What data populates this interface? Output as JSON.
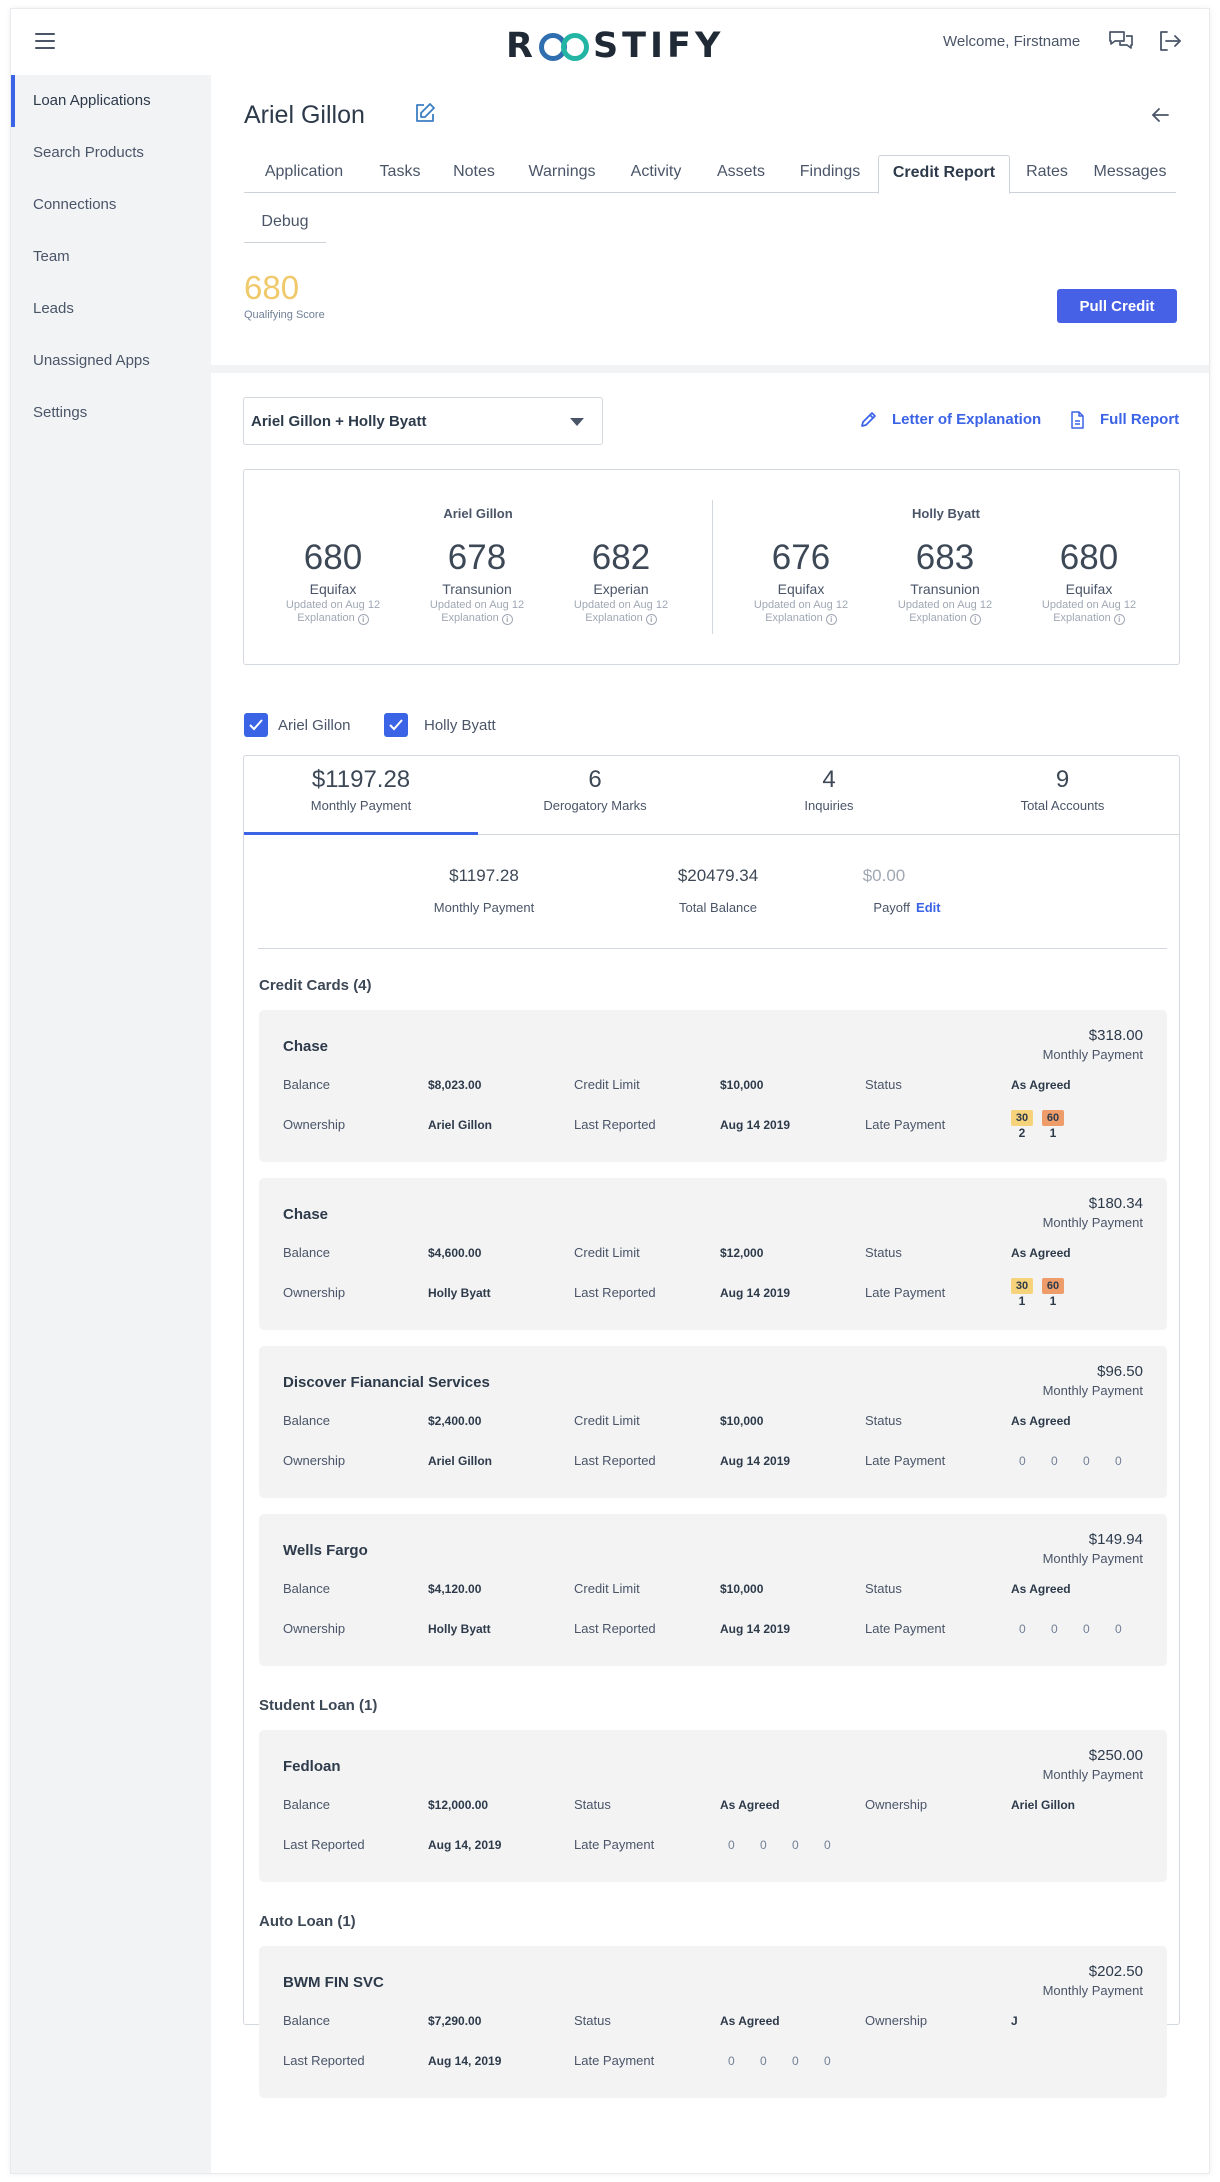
{
  "header": {
    "logo_text": "ROOSTIFY",
    "welcome": "Welcome, Firstname",
    "icons": [
      "menu-icon",
      "chat-icon",
      "logout-icon"
    ]
  },
  "sidebar": {
    "items": [
      {
        "label": "Loan Applications",
        "active": true
      },
      {
        "label": "Search Products"
      },
      {
        "label": "Connections"
      },
      {
        "label": "Team"
      },
      {
        "label": "Leads"
      },
      {
        "label": "Unassigned Apps"
      },
      {
        "label": "Settings"
      }
    ]
  },
  "app": {
    "title": "Ariel Gillon",
    "tabs": [
      "Application",
      "Tasks",
      "Notes",
      "Warnings",
      "Activity",
      "Assets",
      "Findings",
      "Credit Report",
      "Rates",
      "Messages"
    ],
    "active_tab": "Credit Report",
    "tab_row2": "Debug"
  },
  "qualifying": {
    "score": "680",
    "label": "Qualifying Score"
  },
  "pull_credit": "Pull Credit",
  "borrower_select": "Ariel Gillon + Holly Byatt",
  "links": {
    "letter": "Letter of Explanation",
    "full_report": "Full Report"
  },
  "bureau_scores": {
    "update_text": "Updated on Aug 12",
    "explanation_text": "Explanation",
    "borrowers": [
      {
        "name": "Ariel Gillon",
        "scores": [
          {
            "score": "680",
            "bureau": "Equifax"
          },
          {
            "score": "678",
            "bureau": "Transunion"
          },
          {
            "score": "682",
            "bureau": "Experian"
          }
        ]
      },
      {
        "name": "Holly Byatt",
        "scores": [
          {
            "score": "676",
            "bureau": "Equifax"
          },
          {
            "score": "683",
            "bureau": "Transunion"
          },
          {
            "score": "680",
            "bureau": "Equifax"
          }
        ]
      }
    ]
  },
  "filters": [
    {
      "label": "Ariel Gillon",
      "checked": true
    },
    {
      "label": "Holly Byatt",
      "checked": true
    }
  ],
  "stats": [
    {
      "value": "$1197.28",
      "label": "Monthly Payment",
      "active": true
    },
    {
      "value": "6",
      "label": "Derogatory Marks"
    },
    {
      "value": "4",
      "label": "Inquiries"
    },
    {
      "value": "9",
      "label": "Total Accounts"
    }
  ],
  "totals": {
    "monthly_payment": "$1197.28",
    "monthly_payment_label": "Monthly Payment",
    "total_balance": "$20479.34",
    "total_balance_label": "Total Balance",
    "payoff": "$0.00",
    "payoff_label": "Payoff",
    "edit": "Edit"
  },
  "labels": {
    "balance": "Balance",
    "credit_limit": "Credit Limit",
    "status": "Status",
    "ownership": "Ownership",
    "last_reported": "Last Reported",
    "late_payment": "Late Payment",
    "monthly_payment": "Monthly Payment"
  },
  "sections": {
    "credit_cards": "Credit Cards (4)",
    "student_loan": "Student Loan (1)",
    "auto_loan": "Auto Loan (1)"
  },
  "credit_cards": [
    {
      "name": "Chase",
      "payment": "$318.00",
      "balance": "$8,023.00",
      "limit": "$10,000",
      "status": "As Agreed",
      "owner": "Ariel Gillon",
      "reported": "Aug 14 2019",
      "late": [
        {
          "days": "30",
          "count": "2",
          "color": "#f6d27b"
        },
        {
          "days": "60",
          "count": "1",
          "color": "#ef9c6b"
        }
      ]
    },
    {
      "name": "Chase",
      "payment": "$180.34",
      "balance": "$4,600.00",
      "limit": "$12,000",
      "status": "As Agreed",
      "owner": "Holly Byatt",
      "reported": "Aug 14 2019",
      "late": [
        {
          "days": "30",
          "count": "1",
          "color": "#f6d27b"
        },
        {
          "days": "60",
          "count": "1",
          "color": "#ef9c6b"
        }
      ]
    },
    {
      "name": "Discover Fianancial Services",
      "payment": "$96.50",
      "balance": "$2,400.00",
      "limit": "$10,000",
      "status": "As Agreed",
      "owner": "Ariel Gillon",
      "reported": "Aug 14 2019",
      "late_zeros": [
        "0",
        "0",
        "0",
        "0"
      ]
    },
    {
      "name": "Wells Fargo",
      "payment": "$149.94",
      "balance": "$4,120.00",
      "limit": "$10,000",
      "status": "As Agreed",
      "owner": "Holly Byatt",
      "reported": "Aug 14 2019",
      "late_zeros": [
        "0",
        "0",
        "0",
        "0"
      ]
    }
  ],
  "student_loans": [
    {
      "name": "Fedloan",
      "payment": "$250.00",
      "balance": "$12,000.00",
      "status": "As Agreed",
      "owner": "Ariel Gillon",
      "reported": "Aug 14, 2019",
      "late_zeros": [
        "0",
        "0",
        "0",
        "0"
      ]
    }
  ],
  "auto_loans": [
    {
      "name": "BWM FIN SVC",
      "payment": "$202.50",
      "balance": "$7,290.00",
      "status": "As Agreed",
      "owner": "J",
      "reported": "Aug 14, 2019",
      "late_zeros": [
        "0",
        "0",
        "0",
        "0"
      ]
    }
  ],
  "colors": {
    "accent": "#3b63e6",
    "button": "#4761e6",
    "score": "#f0c96a",
    "late30": "#f6d27b",
    "late60": "#ef9c6b"
  }
}
